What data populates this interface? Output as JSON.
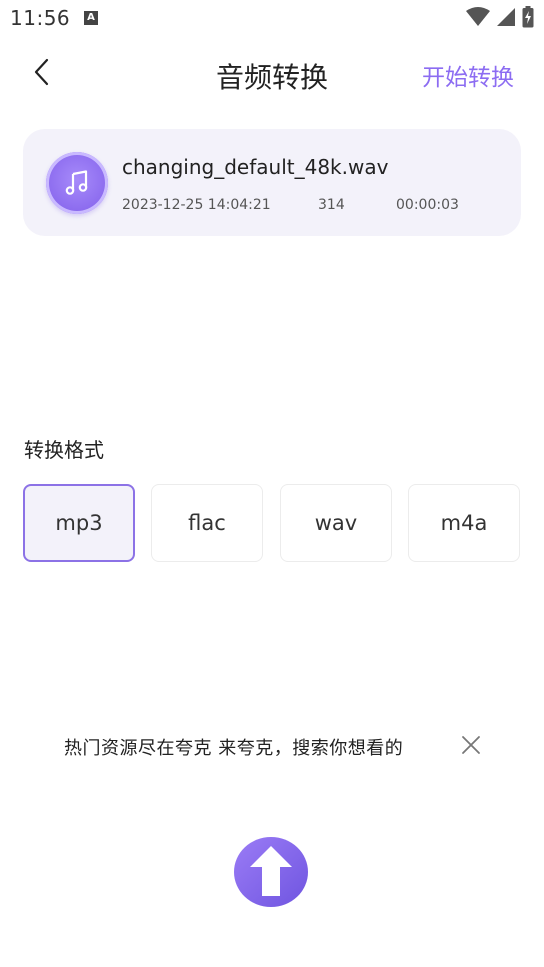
{
  "status_bar": {
    "time": "11:56",
    "notification_glyph": "A",
    "icons": [
      "wifi-icon",
      "signal-icon",
      "battery-icon"
    ]
  },
  "header": {
    "title": "音频转换",
    "start_label": "开始转换"
  },
  "file": {
    "name": "changing_default_48k.wav",
    "date": "2023-12-25 14:04:21",
    "size": "314",
    "duration": "00:00:03"
  },
  "format_section": {
    "label": "转换格式",
    "options": [
      "mp3",
      "flac",
      "wav",
      "m4a"
    ],
    "selected": "mp3"
  },
  "ad": {
    "text": "热门资源尽在夸克 来夸克，搜索你想看的"
  },
  "colors": {
    "accent": "#8c6cf2",
    "card_bg": "#f3f2fa",
    "selected_border": "#8c72e6"
  }
}
